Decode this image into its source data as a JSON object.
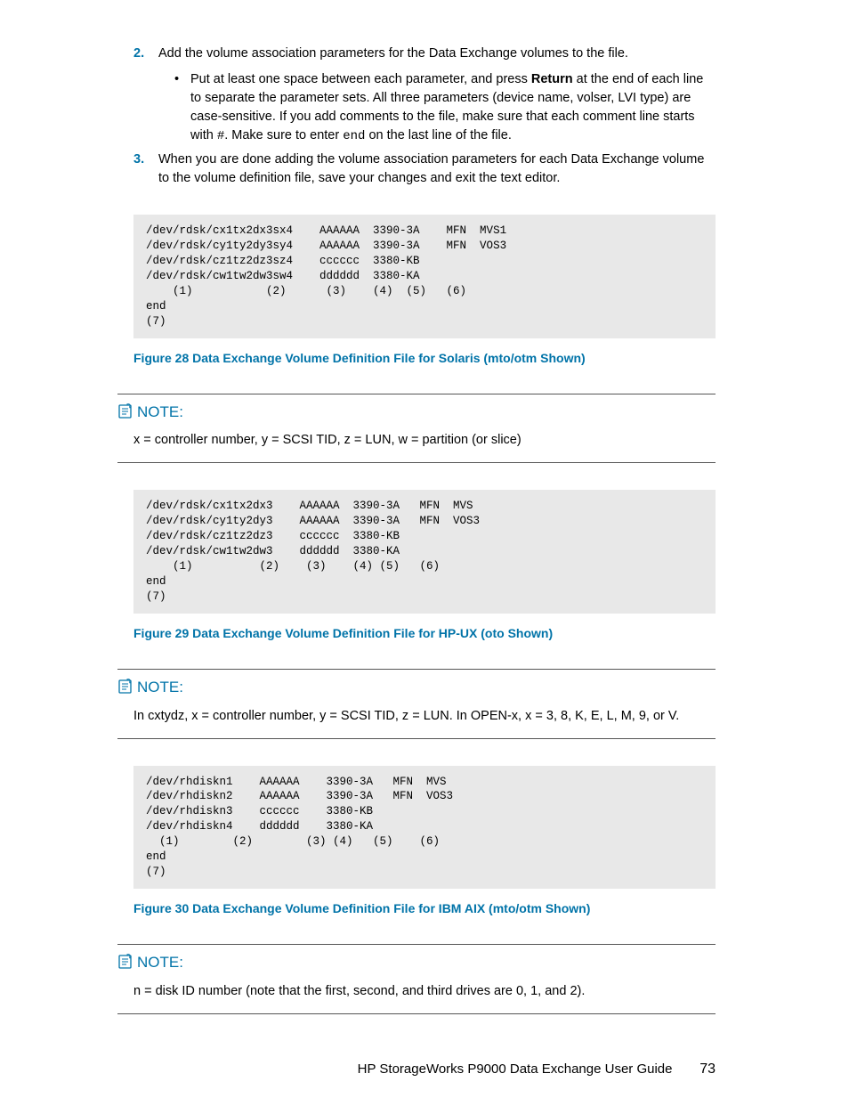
{
  "steps": {
    "s2_num": "2.",
    "s2_text": "Add the volume association parameters for the Data Exchange volumes to the file.",
    "s2_b_pre": "Put at least one space between each parameter, and press ",
    "s2_b_bold": "Return",
    "s2_b_mid": " at the end of each line to separate the parameter sets. All three parameters (device name, volser, LVI type) are case-sensitive. If you add comments to the file, make sure that each comment line starts with ",
    "s2_b_code1": "#",
    "s2_b_mid2": ". Make sure to enter ",
    "s2_b_code2": "end",
    "s2_b_post": " on the last line of the file.",
    "s3_num": "3.",
    "s3_text": "When you are done adding the volume association parameters for each Data Exchange volume to the volume definition file, save your changes and exit the text editor."
  },
  "code1": "/dev/rdsk/cx1tx2dx3sx4    AAAAAA  3390-3A    MFN  MVS1\n/dev/rdsk/cy1ty2dy3sy4    AAAAAA  3390-3A    MFN  VOS3\n/dev/rdsk/cz1tz2dz3sz4    cccccc  3380-KB\n/dev/rdsk/cw1tw2dw3sw4    dddddd  3380-KA\n    (1)           (2)      (3)    (4)  (5)   (6)\nend\n(7)",
  "fig1": "Figure 28 Data Exchange Volume Definition File for Solaris (mto/otm Shown)",
  "note1_head": "NOTE:",
  "note1_body": "x = controller number, y = SCSI TID, z = LUN, w = partition (or slice)",
  "code2": "/dev/rdsk/cx1tx2dx3    AAAAAA  3390-3A   MFN  MVS\n/dev/rdsk/cy1ty2dy3    AAAAAA  3390-3A   MFN  VOS3\n/dev/rdsk/cz1tz2dz3    cccccc  3380-KB\n/dev/rdsk/cw1tw2dw3    dddddd  3380-KA\n    (1)          (2)    (3)    (4) (5)   (6)\nend\n(7)",
  "fig2": "Figure 29 Data Exchange Volume Definition File for HP-UX (oto Shown)",
  "note2_head": "NOTE:",
  "note2_body": "In cxtydz, x = controller number, y = SCSI TID, z = LUN. In OPEN-x, x = 3, 8, K, E, L, M, 9, or V.",
  "code3": "/dev/rhdiskn1    AAAAAA    3390-3A   MFN  MVS\n/dev/rhdiskn2    AAAAAA    3390-3A   MFN  VOS3\n/dev/rhdiskn3    cccccc    3380-KB\n/dev/rhdiskn4    dddddd    3380-KA\n  (1)        (2)        (3) (4)   (5)    (6)\nend\n(7)",
  "fig3": "Figure 30 Data Exchange Volume Definition File for IBM AIX (mto/otm Shown)",
  "note3_head": "NOTE:",
  "note3_body": "n = disk ID number (note that the first, second, and third drives are 0, 1, and 2).",
  "footer_text": "HP StorageWorks P9000 Data Exchange User Guide",
  "page_num": "73"
}
